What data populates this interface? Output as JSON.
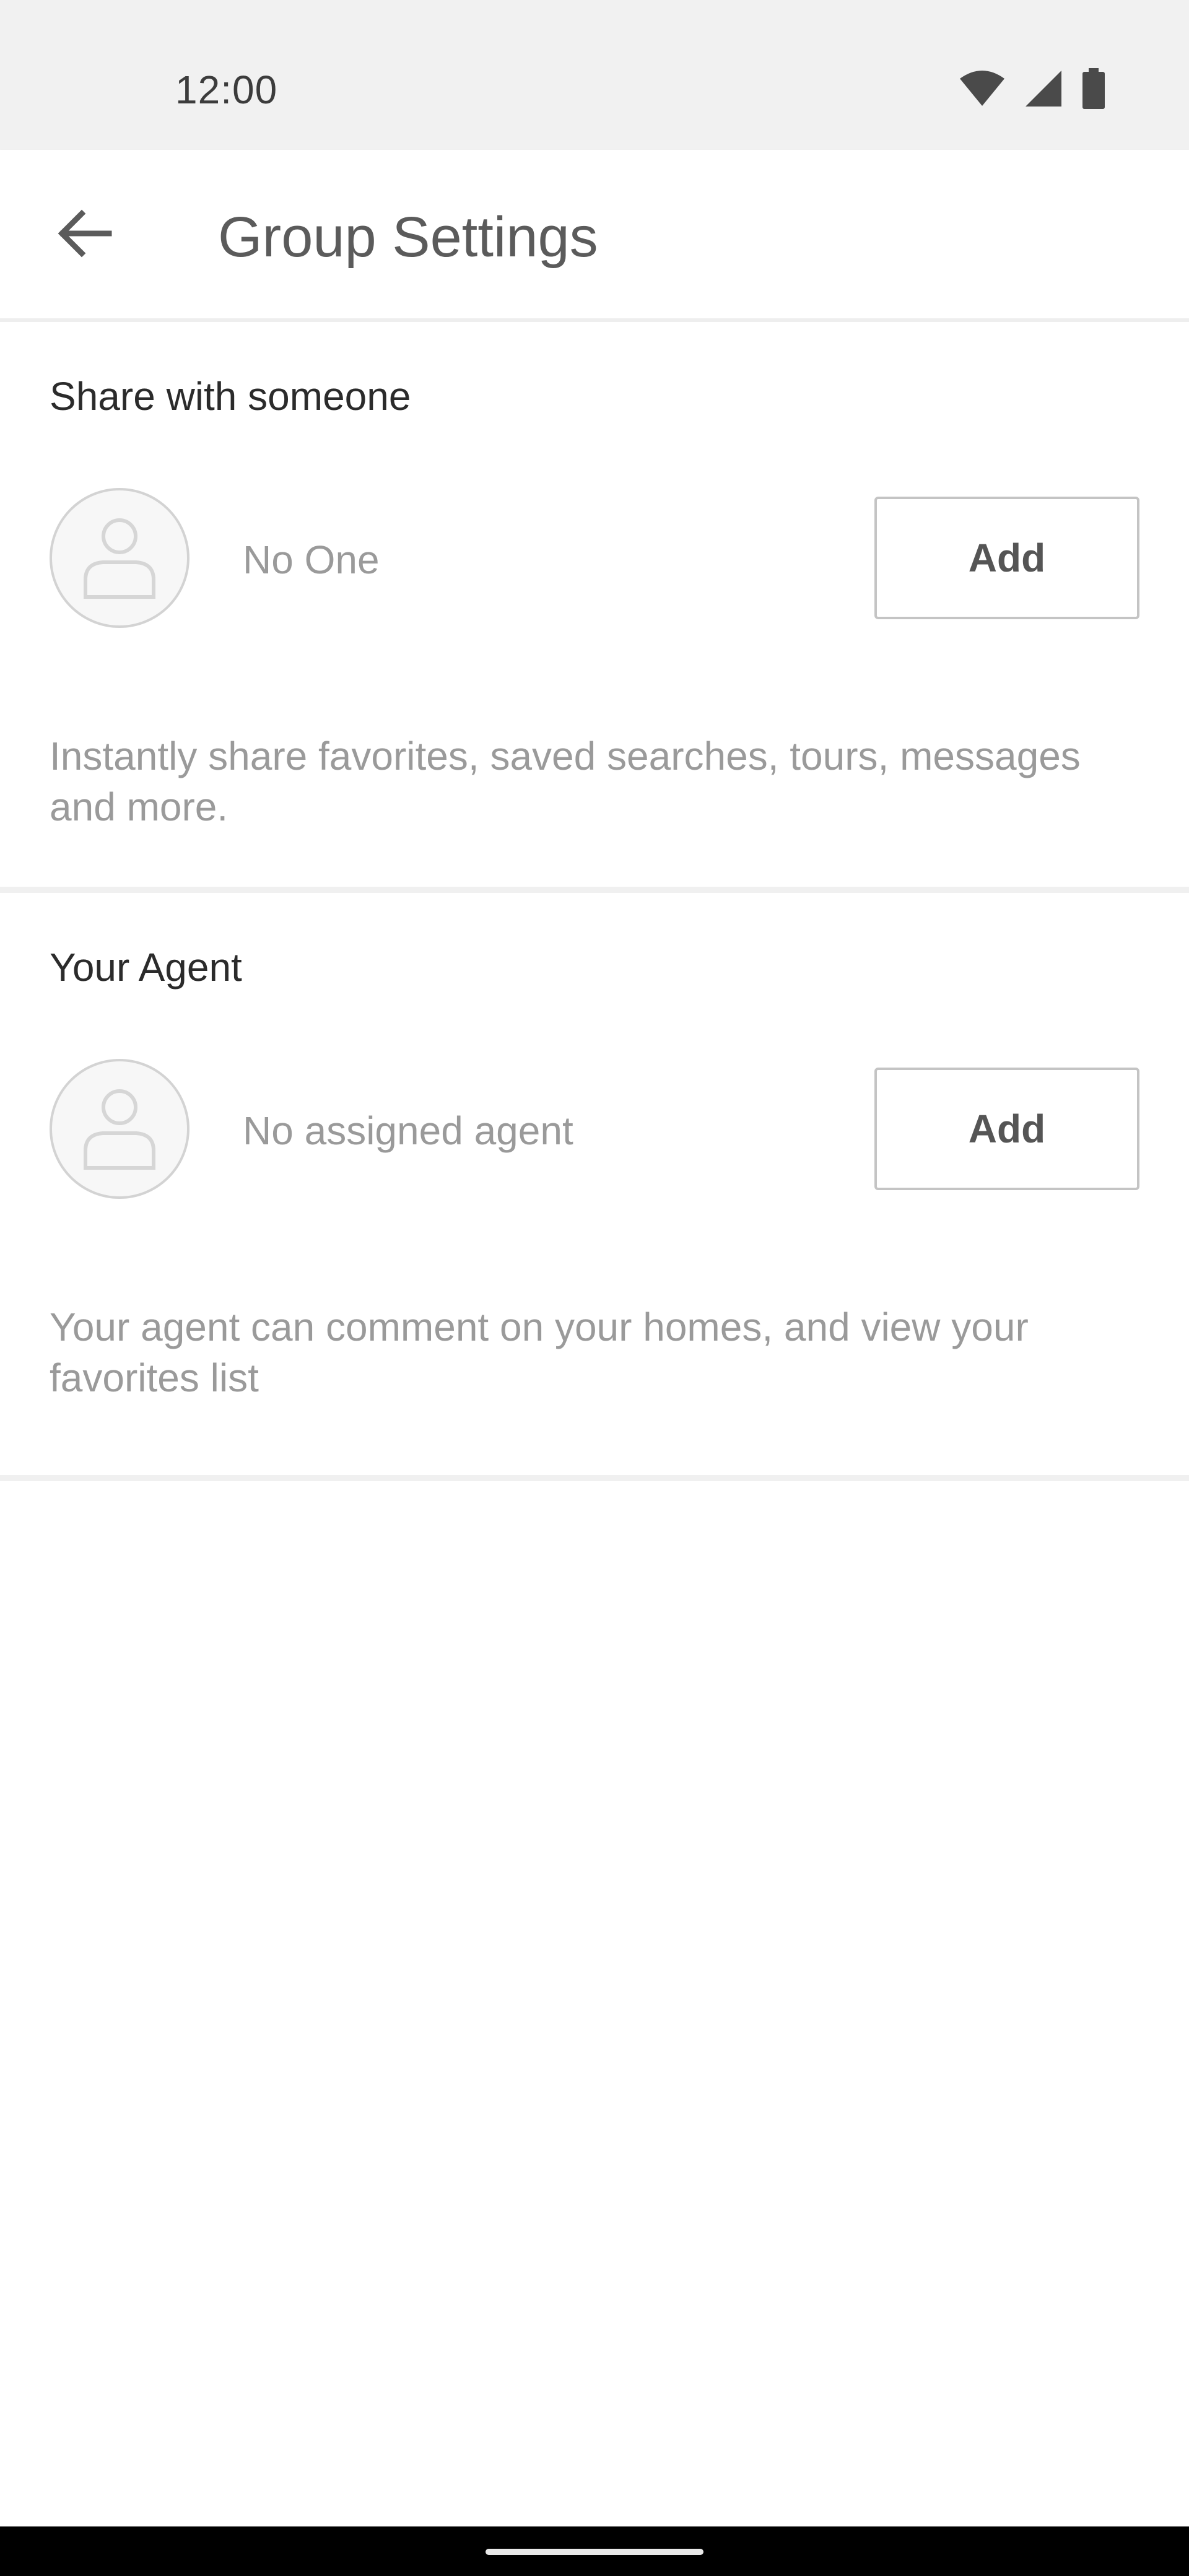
{
  "status_bar": {
    "time": "12:00",
    "icons": [
      "wifi-icon",
      "cell-signal-icon",
      "battery-icon"
    ]
  },
  "app_bar": {
    "back_icon": "arrow-left-icon",
    "title": "Group Settings"
  },
  "share_section": {
    "title": "Share with someone",
    "avatar_icon": "person-placeholder-icon",
    "member_label": "No One",
    "add_label": "Add",
    "description": "Instantly share favorites, saved searches, tours, messages and more."
  },
  "agent_section": {
    "title": "Your Agent",
    "avatar_icon": "person-placeholder-icon",
    "member_label": "No assigned agent",
    "add_label": "Add",
    "description": "Your agent can comment on your homes, and view your favorites list"
  },
  "colors": {
    "status_bar_bg": "#f1f1f1",
    "title_text": "#5b5b5b",
    "muted_text": "#9a9a9a",
    "button_border": "#c4c4c4",
    "nav_bar_bg": "#000000"
  }
}
